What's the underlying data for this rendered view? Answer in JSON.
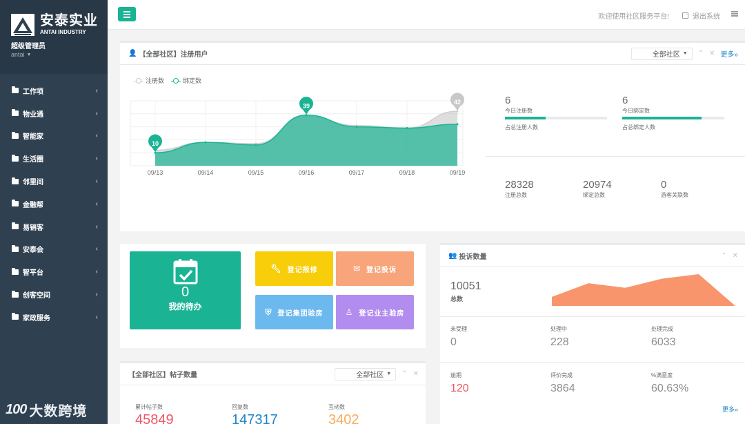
{
  "app": {
    "brand_cn": "安泰实业",
    "brand_en": "ANTAI INDUSTRY",
    "user_role": "超级管理员",
    "user_name": "antai"
  },
  "sidebar": {
    "items": [
      {
        "label": "工作项"
      },
      {
        "label": "物业通"
      },
      {
        "label": "智能家"
      },
      {
        "label": "生活圈"
      },
      {
        "label": "邻里间"
      },
      {
        "label": "金融帮"
      },
      {
        "label": "易销客"
      },
      {
        "label": "安泰会"
      },
      {
        "label": "智平台"
      },
      {
        "label": "创客空间"
      },
      {
        "label": "家政服务"
      }
    ]
  },
  "topbar": {
    "welcome": "欢迎使用社区服务平台!",
    "logout": "退出系统"
  },
  "register_panel": {
    "title": "【全部社区】注册用户",
    "filter": "全部社区",
    "more": "更多»",
    "today_register_value": "6",
    "today_register_label": "今日注册数",
    "today_register_note": "占总注册人数",
    "today_register_progress": 0.4,
    "today_bind_value": "6",
    "today_bind_label": "今日绑定数",
    "today_bind_note": "占总绑定人数",
    "today_bind_progress": 0.78,
    "total_register_value": "28328",
    "total_register_label": "注册总数",
    "total_bind_value": "20974",
    "total_bind_label": "绑定总数",
    "visitor_value": "0",
    "visitor_label": "游客关联数"
  },
  "chart_data": {
    "type": "area",
    "categories": [
      "09/13",
      "09/14",
      "09/15",
      "09/16",
      "09/17",
      "09/18",
      "09/19"
    ],
    "series": [
      {
        "name": "注册数",
        "values": [
          12,
          18,
          17,
          38,
          31,
          29,
          42
        ],
        "color": "#d3d3d3"
      },
      {
        "name": "绑定数",
        "values": [
          10,
          18,
          16,
          39,
          30,
          29,
          32
        ],
        "color": "#1ab394"
      }
    ],
    "markers": [
      {
        "series": "绑定数",
        "index": 0,
        "label": "10"
      },
      {
        "series": "绑定数",
        "index": 3,
        "label": "39"
      },
      {
        "series": "注册数",
        "index": 6,
        "label": "42"
      }
    ],
    "ylim": [
      0,
      50
    ],
    "legend_position": "top-left",
    "grid": true
  },
  "quick_actions": {
    "todo_count": "0",
    "todo_label": "我的待办",
    "repair": "登记报修",
    "complaint": "登记投诉",
    "group_inspection": "登记集团验房",
    "owner_inspection": "登记业主验房"
  },
  "posts_panel": {
    "title": "【全部社区】帖子数量",
    "filter": "全部社区",
    "total_label": "累计帖子数",
    "total_value": "45849",
    "reply_label": "回复数",
    "reply_value": "147317",
    "interact_label": "互动数",
    "interact_value": "3402",
    "colors": {
      "total": "#ed5565",
      "reply": "#1c84c6",
      "interact": "#f8ac59"
    }
  },
  "complaints_panel": {
    "title": "投诉数量",
    "total_value": "10051",
    "total_label": "总数",
    "sparkline": [
      2,
      5,
      4,
      6,
      7,
      0
    ],
    "pending_label": "未受理",
    "pending_value": "0",
    "processing_label": "处理中",
    "processing_value": "228",
    "done_label": "处理完成",
    "done_value": "6033",
    "overdue_label": "逾期",
    "overdue_value": "120",
    "rated_label": "评价完成",
    "rated_value": "3864",
    "satisfaction_label": "%满意度",
    "satisfaction_value": "60.63%",
    "more": "更多»"
  },
  "watermark": {
    "logo": "100",
    "text": "大数跨境"
  }
}
